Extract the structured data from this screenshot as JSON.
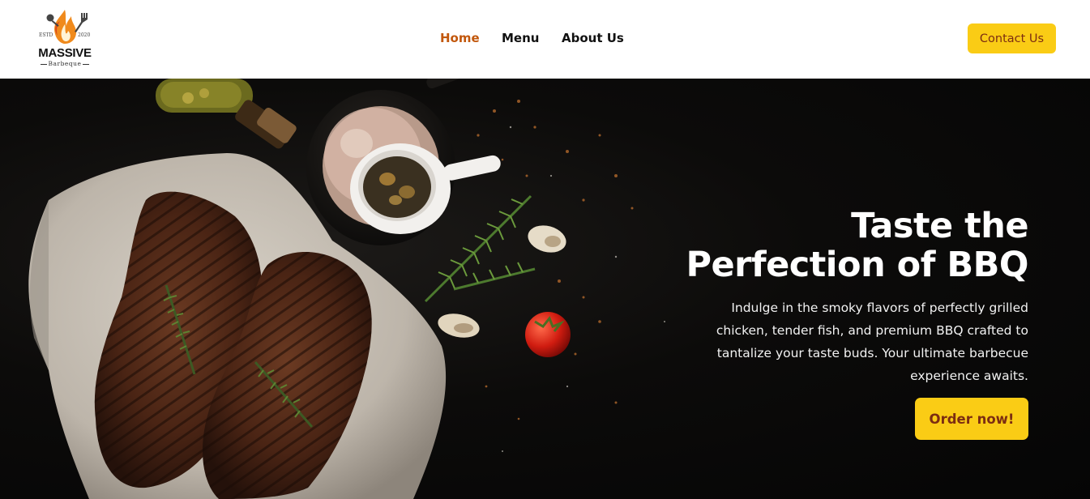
{
  "brand": {
    "estd": "ESTD",
    "year": "2020",
    "name": "MASSIVE",
    "tagline": "Barbeque",
    "colors": {
      "flame": "#f08a1c",
      "flame_dark": "#d9481a"
    }
  },
  "nav": {
    "items": [
      {
        "label": "Home",
        "active": true
      },
      {
        "label": "Menu",
        "active": false
      },
      {
        "label": "About Us",
        "active": false
      }
    ],
    "contact_label": "Contact Us"
  },
  "hero": {
    "title_line1": "Taste the",
    "title_line2": "Perfection of BBQ",
    "description": "Indulge in the smoky flavors of perfectly grilled chicken, tender fish, and premium BBQ crafted to tantalize your taste buds. Your ultimate barbecue experience awaits.",
    "cta_label": "Order now!"
  },
  "colors": {
    "accent": "#facc15",
    "accent_text": "#7c2d12",
    "active_nav": "#c2570c",
    "hero_bg": "#0a0a0a"
  },
  "icons": [
    "flame-logo-icon",
    "grill-fork-icon"
  ]
}
